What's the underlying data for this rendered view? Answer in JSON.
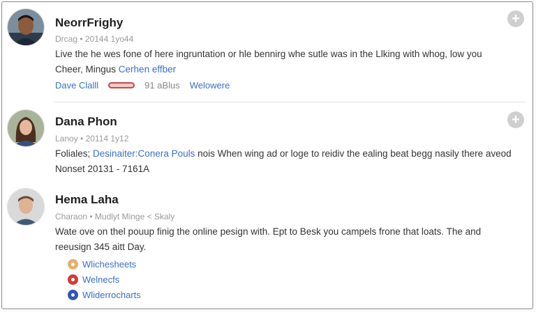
{
  "posts": [
    {
      "name": "NeorrFrighy",
      "meta": "Drcag • 20144 1yo44",
      "body_line1": "Live the he wes fone of here ingruntation or hle bennirg whe sutle was in the Llking with whog, low you",
      "body_line2_text": "Cheer, Mingus ",
      "body_line2_link": "Cerhen effber",
      "actions": {
        "reply": "Dave Clalll",
        "count": "91 aBlus",
        "more": "Welowere"
      },
      "add_label": "+"
    },
    {
      "name": "Dana Phon",
      "meta": "Lanoy • 20114 1y12",
      "body_line1_prefix": "Foliales; ",
      "body_line1_link": "Desinaiter:Conera Pouls",
      "body_line1_rest": " nois When wing ad or loge to reidiv the ealing beat begg nasily there aveod",
      "body_line2": "Nonset 20131 - 7161A",
      "add_label": "+"
    },
    {
      "name": "Hema Laha",
      "meta": "Charaon • Mudlyt Minge < Skaly",
      "body_line1": "Wate ove on thel pouup finig the online pesign with. Ept to Besk you campels frone that loats. The and",
      "body_line2": "reeusign 345 aitt Day.",
      "sublinks": [
        {
          "label": "Wlichesheets",
          "icon": "tan-circle-icon",
          "color": "#e6b06c"
        },
        {
          "label": "Welnecfs",
          "icon": "red-circle-icon",
          "color": "#d23b35"
        },
        {
          "label": "Wliderrocharts",
          "icon": "blue-circle-icon",
          "color": "#2d56b0"
        }
      ]
    }
  ]
}
